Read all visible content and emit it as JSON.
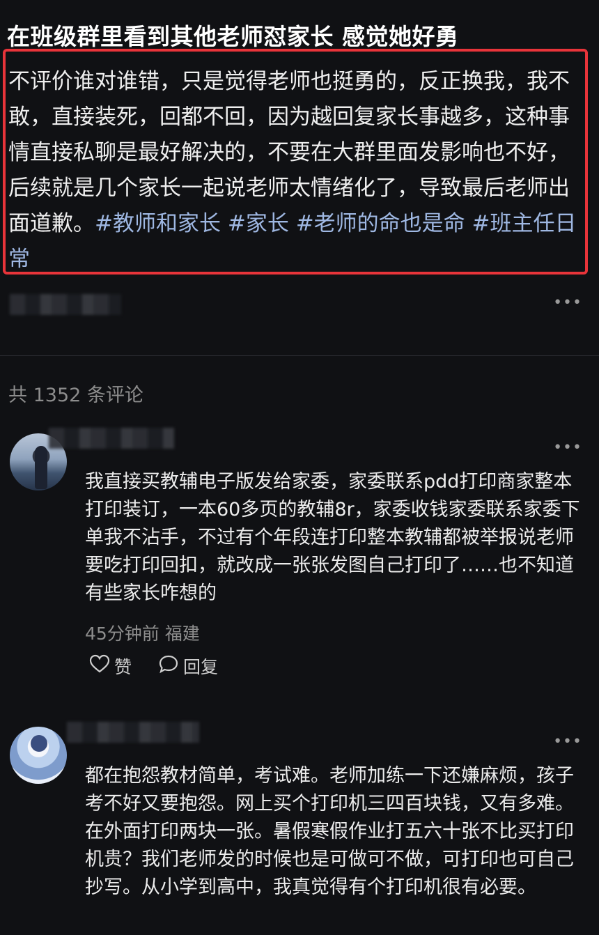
{
  "post": {
    "title": "在班级群里看到其他老师怼家长 感觉她好勇",
    "body": "不评价谁对谁错，只是觉得老师也挺勇的，反正换我，我不敢，直接装死，回都不回，因为越回复家长事越多，这种事情直接私聊是最好解决的，不要在大群里面发影响也不好，后续就是几个家长一起说老师太情绪化了，导致最后老师出面道歉。",
    "tags": [
      "#教师和家长",
      "#家长",
      "#老师的命也是命",
      "#班主任日常"
    ],
    "more_icon": "more-dots-icon"
  },
  "comments_header": {
    "count_label": "共 1352 条评论"
  },
  "comments": [
    {
      "text": "我直接买教辅电子版发给家委，家委联系pdd打印商家整本打印装订，一本60多页的教辅8r，家委收钱家委联系家委下单我不沾手，不过有个年段连打印整本教辅都被举报说老师要吃打印回扣，就改成一张张发图自己打印了……也不知道有些家长咋想的",
      "meta": "45分钟前 福建",
      "like_label": "赞",
      "reply_label": "回复"
    },
    {
      "text": "都在抱怨教材简单，考试难。老师加练一下还嫌麻烦，孩子考不好又要抱怨。网上买个打印机三四百块钱，又有多难。在外面打印两块一张。暑假寒假作业打五六十张不比买打印机贵？我们老师发的时候也是可做可不做，可打印也可自己抄写。从小学到高中，我真觉得有个打印机很有必要。"
    }
  ],
  "colors": {
    "background": "#101114",
    "highlight_border": "#e8343a",
    "tag": "#9fb8e3",
    "muted": "#8d8d8d"
  }
}
